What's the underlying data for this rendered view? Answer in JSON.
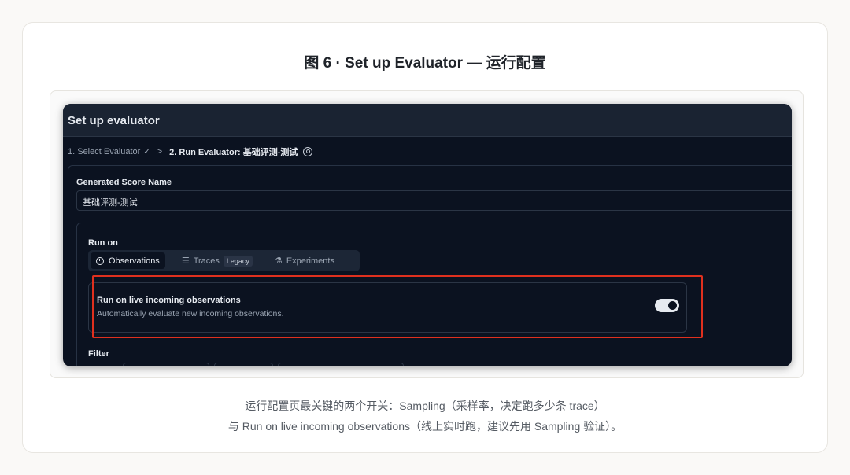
{
  "figure": {
    "title": "图 6 · Set up Evaluator — 运行配置",
    "caption_line1": "运行配置页最关键的两个开关：Sampling（采样率，决定跑多少条 trace）",
    "caption_line2": "与 Run on live incoming observations（线上实时跑，建议先用 Sampling 验证）。"
  },
  "app": {
    "title": "Set up evaluator",
    "breadcrumb": {
      "step1": "1. Select Evaluator",
      "step1_check": "✓",
      "separator": ">",
      "step2": "2. Run Evaluator: 基础评测-测试"
    },
    "score": {
      "label": "Generated Score Name",
      "value": "基础评测-测试"
    },
    "run_on": {
      "label": "Run on",
      "tabs": [
        {
          "label": "Observations",
          "icon": "clock-icon",
          "active": true
        },
        {
          "label": "Traces",
          "icon": "list-tree-icon",
          "badge": "Legacy"
        },
        {
          "label": "Experiments",
          "icon": "flask-icon"
        }
      ],
      "live": {
        "title": "Run on live incoming observations",
        "description": "Automatically evaluate new incoming observations.",
        "enabled": true
      }
    },
    "filter": {
      "label": "Filter"
    }
  },
  "colors": {
    "highlight": "#e0301e",
    "screen_bg": "#0b1220",
    "header_bg": "#1a2332"
  }
}
